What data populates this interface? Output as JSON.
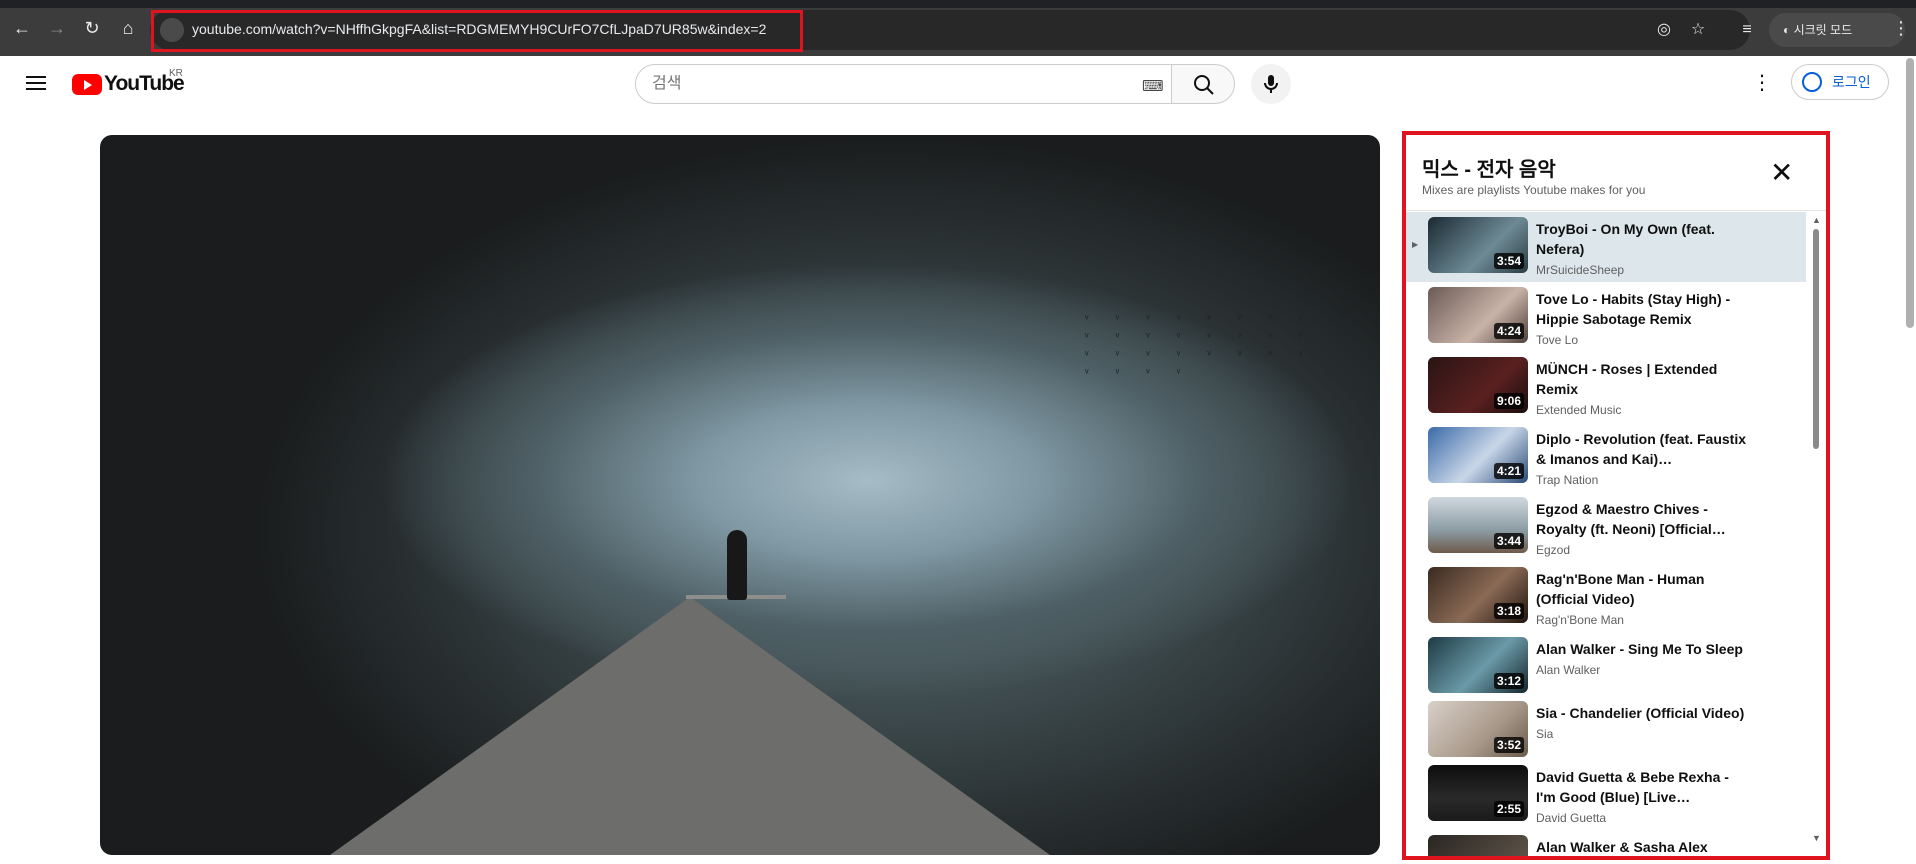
{
  "browser": {
    "url": "youtube.com/watch?v=NHffhGkpgFA&list=RDGMEMYH9CUrFO7CfLJpaD7UR85w&index=2",
    "incognito_label": "시크릿 모드"
  },
  "header": {
    "logo_text": "YouTube",
    "region": "KR",
    "search_placeholder": "검색",
    "signin_label": "로그인"
  },
  "playlist": {
    "title": "믹스 - 전자 음악",
    "subtitle": "Mixes are playlists Youtube makes for you",
    "items": [
      {
        "title": "TroyBoi - On My Own (feat. Nefera)",
        "channel": "MrSuicideSheep",
        "duration": "3:54"
      },
      {
        "title": "Tove Lo - Habits (Stay High) - Hippie Sabotage Remix",
        "channel": "Tove Lo",
        "duration": "4:24"
      },
      {
        "title": "MÜNCH - Roses | Extended Remix",
        "channel": "Extended Music",
        "duration": "9:06"
      },
      {
        "title": "Diplo - Revolution (feat. Faustix & Imanos and Kai)…",
        "channel": "Trap Nation",
        "duration": "4:21"
      },
      {
        "title": "Egzod & Maestro Chives - Royalty (ft. Neoni) [Official…",
        "channel": "Egzod",
        "duration": "3:44"
      },
      {
        "title": "Rag'n'Bone Man - Human (Official Video)",
        "channel": "Rag'n'Bone Man",
        "duration": "3:18"
      },
      {
        "title": "Alan Walker - Sing Me To Sleep",
        "channel": "Alan Walker",
        "duration": "3:12"
      },
      {
        "title": "Sia - Chandelier (Official Video)",
        "channel": "Sia",
        "duration": "3:52"
      },
      {
        "title": "David Guetta & Bebe Rexha - I'm Good (Blue) [Live…",
        "channel": "David Guetta",
        "duration": "2:55"
      },
      {
        "title": "Alan Walker & Sasha Alex",
        "channel": "",
        "duration": ""
      }
    ]
  },
  "icons": {
    "back": "back-arrow-icon",
    "forward": "forward-arrow-icon",
    "reload": "reload-icon",
    "home": "home-icon"
  },
  "colors": {
    "highlight": "#e0141e",
    "yt_red": "#ff0000",
    "link_blue": "#065fd4"
  }
}
